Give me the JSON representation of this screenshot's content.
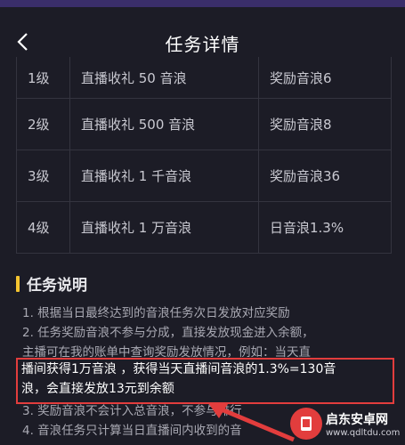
{
  "header": {
    "title": "任务详情",
    "back_icon": "chevron-left-icon"
  },
  "table": {
    "rows": [
      {
        "level": "1级",
        "task": "直播收礼 50 音浪",
        "reward": "奖励音浪6"
      },
      {
        "level": "2级",
        "task": "直播收礼 500 音浪",
        "reward": "奖励音浪8"
      },
      {
        "level": "3级",
        "task": "直播收礼 1 千音浪",
        "reward": "奖励音浪36"
      },
      {
        "level": "4级",
        "task": "直播收礼 1 万音浪",
        "reward": "日音浪1.3%"
      }
    ]
  },
  "section": {
    "title": "任务说明",
    "accent_color": "#f4c430"
  },
  "description": {
    "lines": [
      "1. 根据当日最终达到的音浪任务次日发放对应奖励",
      "2. 任务奖励音浪不参与分成，直接发放现金进入余额，",
      "主播可在我的账单中查询奖励发放情况，例如：当天直",
      "3. 奖励音浪不会计入总音浪，不参与排行",
      "4. 音浪任务只计算当日直播间内收到的音"
    ],
    "highlight_lines": [
      "播间获得1万音浪 ，获得当天直播间音浪的1.3%=130音",
      "浪，会直接发放13元到余额"
    ]
  },
  "watermark": {
    "name": "启东安卓网",
    "url": "www.qdltdu.com"
  }
}
